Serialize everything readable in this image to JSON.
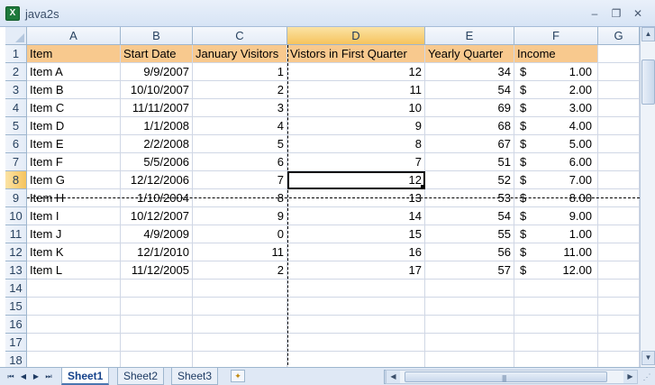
{
  "window": {
    "title": "java2s",
    "icon": "excel-icon",
    "min_glyph": "–",
    "restore_glyph": "❐",
    "close_glyph": "✕"
  },
  "columns": [
    "A",
    "B",
    "C",
    "D",
    "E",
    "F",
    "G"
  ],
  "rows": [
    "1",
    "2",
    "3",
    "4",
    "5",
    "6",
    "7",
    "8",
    "9",
    "10",
    "11",
    "12",
    "13",
    "14",
    "15",
    "16",
    "17",
    "18"
  ],
  "selected": {
    "column": "D",
    "row": "8",
    "cell": "D8"
  },
  "headers": {
    "a": "Item",
    "b": "Start Date",
    "c": "January Visitors",
    "d": "Vistors in First Quarter",
    "e": "Yearly Quarter",
    "f": "Income"
  },
  "data": [
    {
      "a": "Item A",
      "b": "9/9/2007",
      "c": "1",
      "d": "12",
      "e": "34",
      "cur": "$",
      "f": "1.00"
    },
    {
      "a": "Item B",
      "b": "10/10/2007",
      "c": "2",
      "d": "11",
      "e": "54",
      "cur": "$",
      "f": "2.00"
    },
    {
      "a": "Item C",
      "b": "11/11/2007",
      "c": "3",
      "d": "10",
      "e": "69",
      "cur": "$",
      "f": "3.00"
    },
    {
      "a": "Item D",
      "b": "1/1/2008",
      "c": "4",
      "d": "9",
      "e": "68",
      "cur": "$",
      "f": "4.00"
    },
    {
      "a": "Item E",
      "b": "2/2/2008",
      "c": "5",
      "d": "8",
      "e": "67",
      "cur": "$",
      "f": "5.00"
    },
    {
      "a": "Item F",
      "b": "5/5/2006",
      "c": "6",
      "d": "7",
      "e": "51",
      "cur": "$",
      "f": "6.00"
    },
    {
      "a": "Item G",
      "b": "12/12/2006",
      "c": "7",
      "d": "12",
      "e": "52",
      "cur": "$",
      "f": "7.00"
    },
    {
      "a": "Item H",
      "b": "1/10/2004",
      "c": "8",
      "d": "13",
      "e": "53",
      "cur": "$",
      "f": "8.00"
    },
    {
      "a": "Item I",
      "b": "10/12/2007",
      "c": "9",
      "d": "14",
      "e": "54",
      "cur": "$",
      "f": "9.00"
    },
    {
      "a": "Item J",
      "b": "4/9/2009",
      "c": "0",
      "d": "15",
      "e": "55",
      "cur": "$",
      "f": "1.00"
    },
    {
      "a": "Item K",
      "b": "12/1/2010",
      "c": "11",
      "d": "16",
      "e": "56",
      "cur": "$",
      "f": "11.00"
    },
    {
      "a": "Item L",
      "b": "11/12/2005",
      "c": "2",
      "d": "17",
      "e": "57",
      "cur": "$",
      "f": "12.00"
    }
  ],
  "sheets": [
    "Sheet1",
    "Sheet2",
    "Sheet3"
  ],
  "active_sheet": "Sheet1",
  "nav": {
    "first": "⏮",
    "prev": "◀",
    "next": "▶",
    "last": "⏭"
  },
  "scroll": {
    "up": "▲",
    "down": "▼",
    "left": "◀",
    "right": "▶",
    "grip": "||||"
  },
  "colors": {
    "header_fill": "#f8c98e",
    "selection": "#f6c35d",
    "chrome": "#dfe8f5"
  }
}
